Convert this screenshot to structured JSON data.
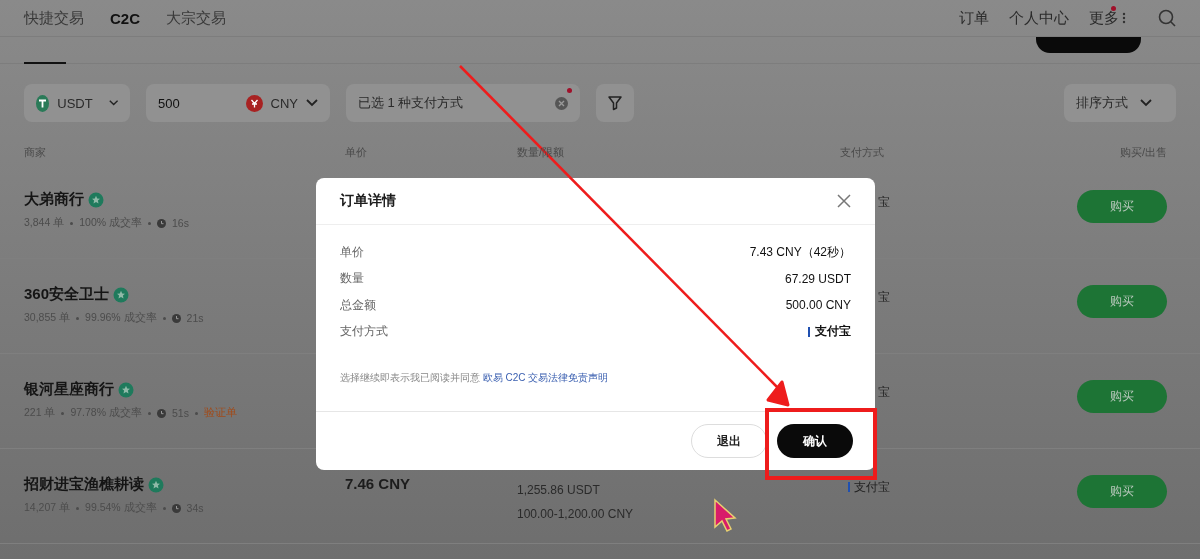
{
  "nav": {
    "tabs": [
      {
        "label": "快捷交易",
        "selected": false
      },
      {
        "label": "C2C",
        "selected": true
      },
      {
        "label": "大宗交易",
        "selected": false
      }
    ],
    "links": [
      {
        "label": "订单",
        "badge": false
      },
      {
        "label": "个人中心",
        "badge": false
      },
      {
        "label": "更多",
        "badge": true
      }
    ]
  },
  "filters": {
    "crypto": {
      "label": "USDT"
    },
    "amount": {
      "value": "500"
    },
    "fiat": {
      "label": "CNY"
    },
    "payment": {
      "value": "已选 1 种支付方式",
      "badge": true
    },
    "sort": {
      "label": "排序方式"
    }
  },
  "columns": [
    "商家",
    "单价",
    "数量/限额",
    "支付方式",
    "购买/出售"
  ],
  "rows": [
    {
      "name": "大弟商行",
      "verified": true,
      "stats": [
        {
          "kind": "text",
          "text": "3,844 单"
        },
        {
          "kind": "text",
          "text": "100% 成交率"
        },
        {
          "kind": "time",
          "text": "16s"
        }
      ],
      "payment": "宝",
      "action": "购买"
    },
    {
      "name": "360安全卫士",
      "verified": true,
      "stats": [
        {
          "kind": "text",
          "text": "30,855 单"
        },
        {
          "kind": "text",
          "text": "99.96% 成交率"
        },
        {
          "kind": "time",
          "text": "21s"
        }
      ],
      "payment": "宝",
      "action": "购买"
    },
    {
      "name": "银河星座商行",
      "verified": true,
      "stats": [
        {
          "kind": "text",
          "text": "221 单"
        },
        {
          "kind": "text",
          "text": "97.78% 成交率"
        },
        {
          "kind": "time",
          "text": "51s"
        },
        {
          "kind": "tag",
          "text": "验证单"
        }
      ],
      "payment": "宝",
      "action": "购买"
    },
    {
      "name": "招财进宝渔樵耕读",
      "verified": true,
      "stats": [
        {
          "kind": "text",
          "text": "14,207 单"
        },
        {
          "kind": "text",
          "text": "99.54% 成交率"
        },
        {
          "kind": "time",
          "text": "34s"
        }
      ],
      "price": "7.46 CNY",
      "quantity": "1,255.86 USDT",
      "limit": "100.00-1,200.00 CNY",
      "payment": "支付宝",
      "payment_icon": true,
      "action": "购买"
    }
  ],
  "modal": {
    "title": "订单详情",
    "fields": [
      {
        "label": "单价",
        "value": "7.43 CNY（42秒）",
        "icon": false
      },
      {
        "label": "数量",
        "value": "67.29 USDT",
        "icon": false
      },
      {
        "label": "总金额",
        "value": "500.00 CNY",
        "icon": false
      },
      {
        "label": "支付方式",
        "value": "支付宝",
        "icon": true
      }
    ],
    "disclaimer": {
      "text": "选择继续即表示我已阅读并同意",
      "link": "欧易 C2C 交易法律免责声明"
    },
    "buttons": [
      {
        "label": "退出",
        "kind": "secondary"
      },
      {
        "label": "确认",
        "kind": "primary"
      }
    ]
  }
}
